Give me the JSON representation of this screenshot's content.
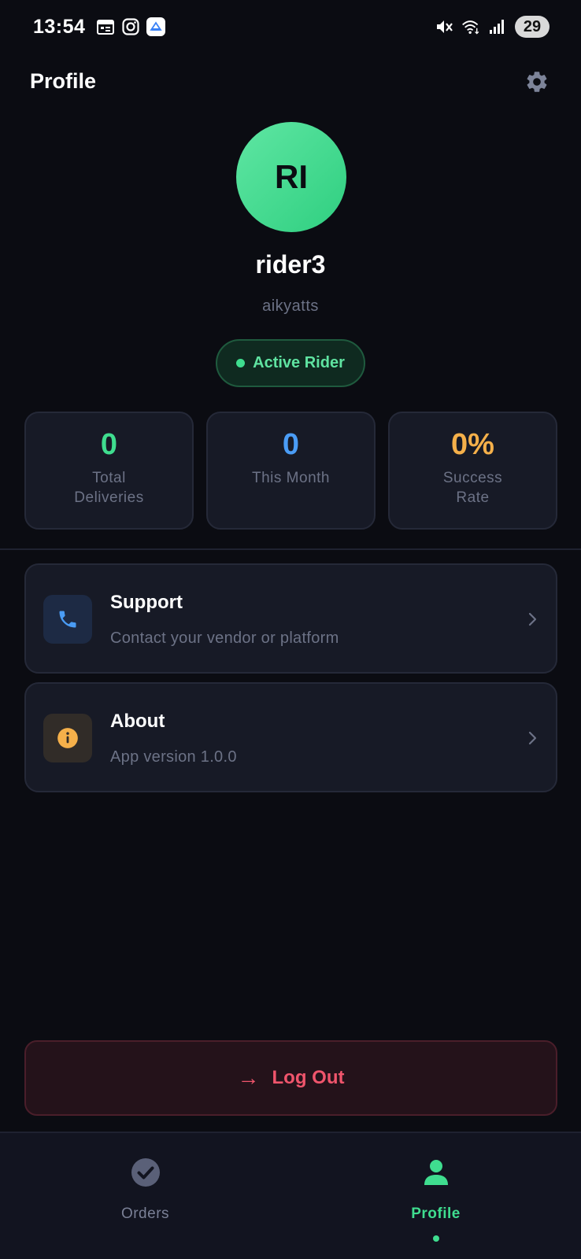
{
  "status_bar": {
    "time": "13:54",
    "battery": "29",
    "left_icons": [
      "calendar-icon",
      "instagram-icon",
      "app-icon"
    ],
    "right_icons": [
      "mute-icon",
      "wifi-icon",
      "signal-icon"
    ]
  },
  "header": {
    "title": "Profile",
    "settings_icon": "gear-icon"
  },
  "profile": {
    "initials": "RI",
    "name": "rider3",
    "handle": "aikyatts",
    "status": "Active Rider",
    "status_color": "#3fdd8f"
  },
  "stats": [
    {
      "value": "0",
      "label": "Total Deliveries",
      "color": "#3fdd8f"
    },
    {
      "value": "0",
      "label": "This Month",
      "color": "#4a9cf5"
    },
    {
      "value": "0%",
      "label": "Success Rate",
      "color": "#f5b04a"
    }
  ],
  "menu": [
    {
      "title": "Support",
      "subtitle": "Contact your vendor or platform",
      "icon": "phone-icon",
      "icon_color": "#4a9cf5"
    },
    {
      "title": "About",
      "subtitle": "App version 1.0.0",
      "icon": "info-icon",
      "icon_color": "#f5b04a"
    }
  ],
  "logout": {
    "arrow": "→",
    "label": "Log Out",
    "color": "#f0556c"
  },
  "bottom_nav": {
    "items": [
      {
        "label": "Orders",
        "icon": "check-circle-icon",
        "active": false
      },
      {
        "label": "Profile",
        "icon": "person-icon",
        "active": true
      }
    ],
    "active_color": "#3fdd8f",
    "inactive_color": "#7a8096"
  }
}
